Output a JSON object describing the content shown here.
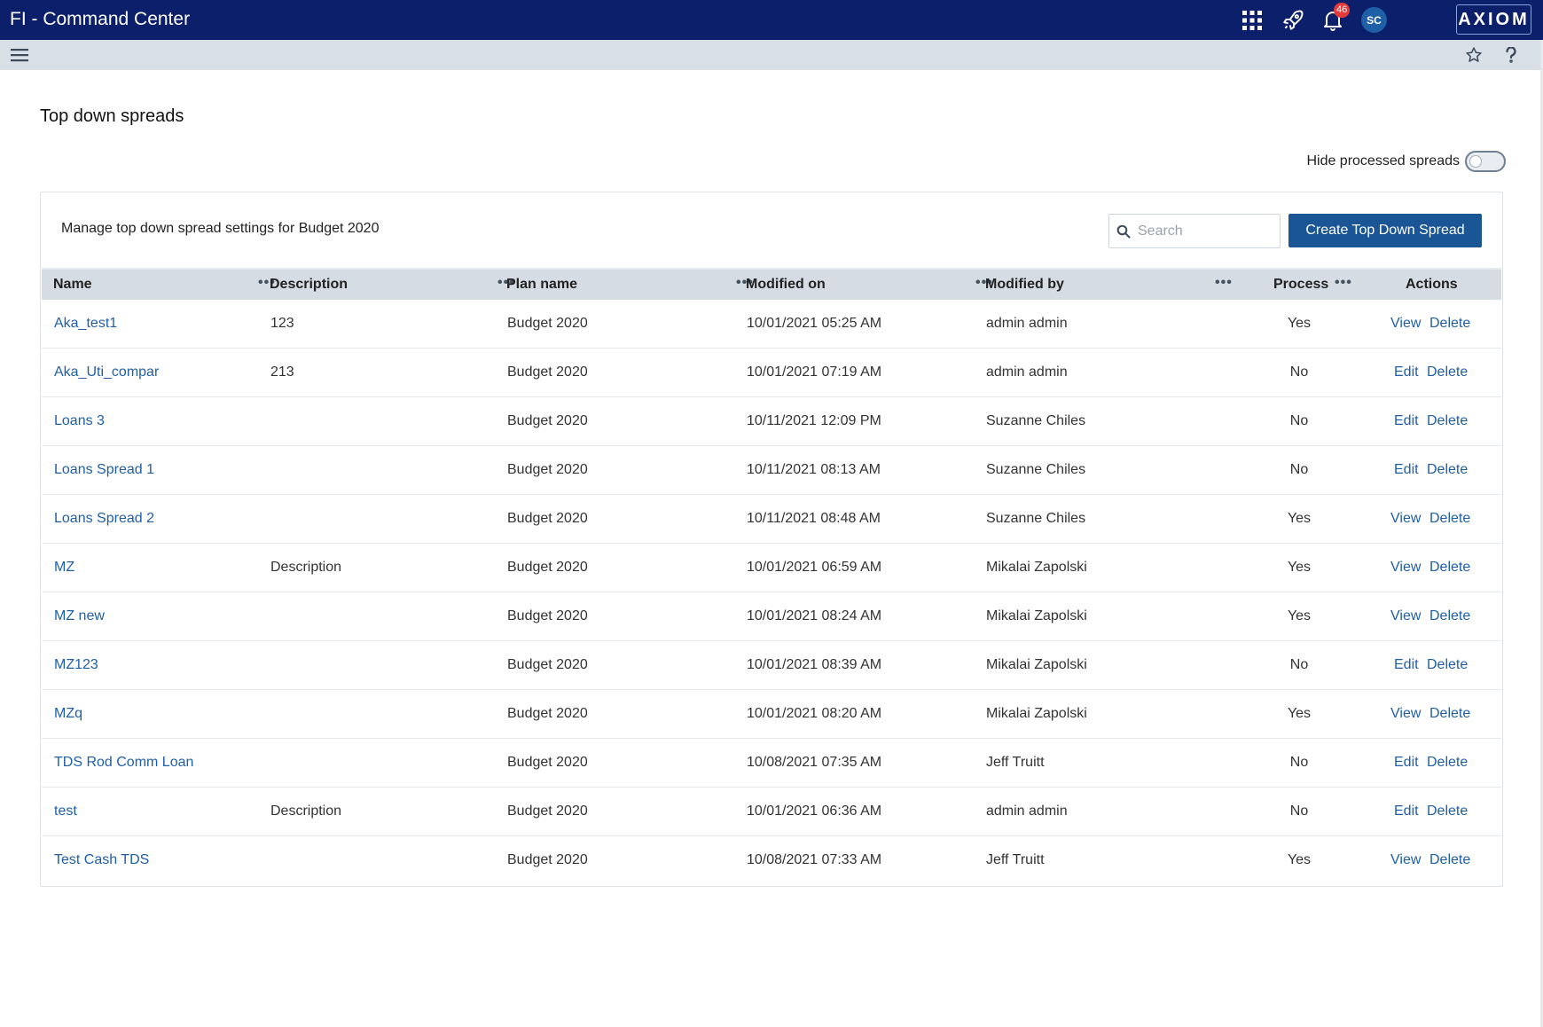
{
  "app": {
    "title": "FI - Command Center",
    "notification_count": "46",
    "avatar_initials": "SC",
    "logo_text": "AXIOM"
  },
  "page": {
    "title": "Top down spreads",
    "hide_processed_label": "Hide processed spreads",
    "hide_processed_on": false
  },
  "panel": {
    "description": "Manage top down spread settings for Budget 2020",
    "search_placeholder": "Search",
    "create_button": "Create Top Down Spread"
  },
  "columns": {
    "name": "Name",
    "description": "Description",
    "plan_name": "Plan name",
    "modified_on": "Modified on",
    "modified_by": "Modified by",
    "process": "Process",
    "actions": "Actions",
    "menu_glyph": "•••"
  },
  "rows": [
    {
      "name": "Aka_test1",
      "description": "123",
      "plan": "Budget 2020",
      "modified_on": "10/01/2021 05:25 AM",
      "modified_by": "admin admin",
      "process": "Yes",
      "action1": "View",
      "action2": "Delete"
    },
    {
      "name": "Aka_Uti_compar",
      "description": "213",
      "plan": "Budget 2020",
      "modified_on": "10/01/2021 07:19 AM",
      "modified_by": "admin admin",
      "process": "No",
      "action1": "Edit",
      "action2": "Delete"
    },
    {
      "name": "Loans 3",
      "description": "",
      "plan": "Budget 2020",
      "modified_on": "10/11/2021 12:09 PM",
      "modified_by": "Suzanne Chiles",
      "process": "No",
      "action1": "Edit",
      "action2": "Delete"
    },
    {
      "name": "Loans Spread 1",
      "description": "",
      "plan": "Budget 2020",
      "modified_on": "10/11/2021 08:13 AM",
      "modified_by": "Suzanne Chiles",
      "process": "No",
      "action1": "Edit",
      "action2": "Delete"
    },
    {
      "name": "Loans Spread 2",
      "description": "",
      "plan": "Budget 2020",
      "modified_on": "10/11/2021 08:48 AM",
      "modified_by": "Suzanne Chiles",
      "process": "Yes",
      "action1": "View",
      "action2": "Delete"
    },
    {
      "name": "MZ",
      "description": "Description",
      "plan": "Budget 2020",
      "modified_on": "10/01/2021 06:59 AM",
      "modified_by": "Mikalai Zapolski",
      "process": "Yes",
      "action1": "View",
      "action2": "Delete"
    },
    {
      "name": "MZ new",
      "description": "",
      "plan": "Budget 2020",
      "modified_on": "10/01/2021 08:24 AM",
      "modified_by": "Mikalai Zapolski",
      "process": "Yes",
      "action1": "View",
      "action2": "Delete"
    },
    {
      "name": "MZ123",
      "description": "",
      "plan": "Budget 2020",
      "modified_on": "10/01/2021 08:39 AM",
      "modified_by": "Mikalai Zapolski",
      "process": "No",
      "action1": "Edit",
      "action2": "Delete"
    },
    {
      "name": "MZq",
      "description": "",
      "plan": "Budget 2020",
      "modified_on": "10/01/2021 08:20 AM",
      "modified_by": "Mikalai Zapolski",
      "process": "Yes",
      "action1": "View",
      "action2": "Delete"
    },
    {
      "name": "TDS Rod Comm Loan",
      "description": "",
      "plan": "Budget 2020",
      "modified_on": "10/08/2021 07:35 AM",
      "modified_by": "Jeff Truitt",
      "process": "No",
      "action1": "Edit",
      "action2": "Delete"
    },
    {
      "name": "test",
      "description": "Description",
      "plan": "Budget 2020",
      "modified_on": "10/01/2021 06:36 AM",
      "modified_by": "admin admin",
      "process": "No",
      "action1": "Edit",
      "action2": "Delete"
    },
    {
      "name": "Test Cash TDS",
      "description": "",
      "plan": "Budget 2020",
      "modified_on": "10/08/2021 07:33 AM",
      "modified_by": "Jeff Truitt",
      "process": "Yes",
      "action1": "View",
      "action2": "Delete"
    }
  ],
  "colors": {
    "topbar": "#0b1f6b",
    "subbar": "#d9dfe6",
    "link": "#1f5fa8",
    "primary_button": "#1a5696",
    "badge": "#e23b3b"
  }
}
